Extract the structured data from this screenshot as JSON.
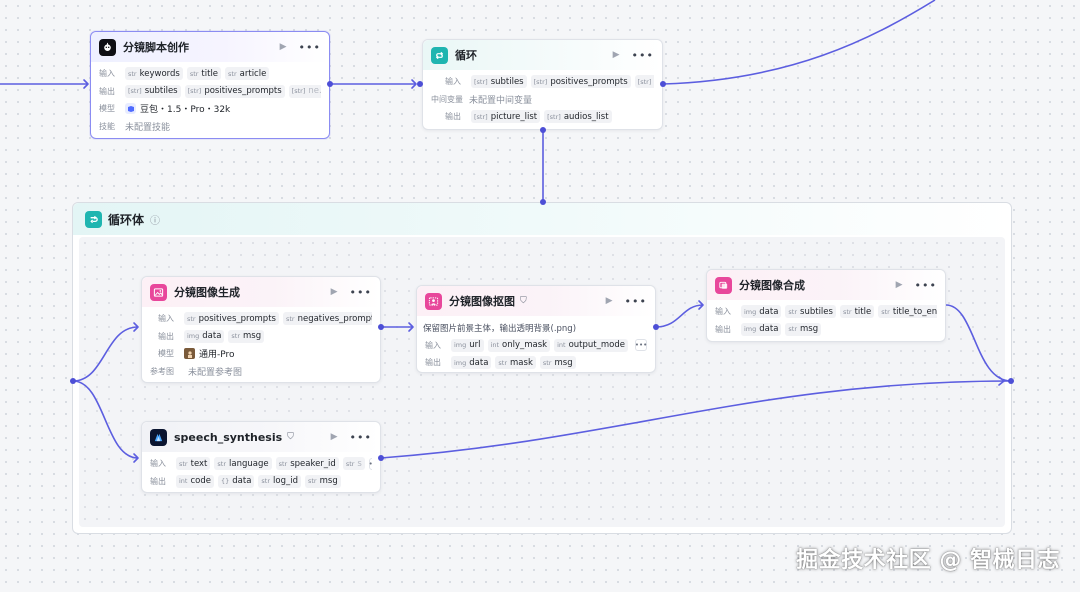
{
  "canvas": {
    "accent_color": "#5c5ee0",
    "loop_body": {
      "title": "循环体",
      "info_icon": "info-icon"
    }
  },
  "nodes": {
    "script": {
      "title": "分镜脚本创作",
      "icon": "llm-robot-icon",
      "labels": {
        "input": "输入",
        "output": "输出",
        "model": "模型",
        "skill": "技能"
      },
      "inputs": [
        {
          "type": "str",
          "name": "keywords"
        },
        {
          "type": "str",
          "name": "title"
        },
        {
          "type": "str",
          "name": "article"
        }
      ],
      "outputs": [
        {
          "type": "[str]",
          "name": "subtiles"
        },
        {
          "type": "[str]",
          "name": "positives_prompts"
        },
        {
          "type": "[str]",
          "name": "ne..."
        }
      ],
      "model": "豆包・1.5・Pro・32k",
      "skill": "未配置技能"
    },
    "loop": {
      "title": "循环",
      "icon": "loop-icon",
      "labels": {
        "input": "输入",
        "intermediate": "中间变量",
        "output": "输出"
      },
      "inputs": [
        {
          "type": "[str]",
          "name": "subtiles"
        },
        {
          "type": "[str]",
          "name": "positives_prompts"
        },
        {
          "type": "[str]",
          "name": "ne"
        }
      ],
      "intermediate": "未配置中间变量",
      "outputs": [
        {
          "type": "[str]",
          "name": "picture_list"
        },
        {
          "type": "[str]",
          "name": "audios_list"
        }
      ]
    },
    "image_gen": {
      "title": "分镜图像生成",
      "icon": "image-icon",
      "labels": {
        "input": "输入",
        "output": "输出",
        "model": "模型",
        "reference": "参考图"
      },
      "inputs": [
        {
          "type": "str",
          "name": "positives_prompts"
        },
        {
          "type": "str",
          "name": "negatives_prompts"
        }
      ],
      "outputs": [
        {
          "type": "img",
          "name": "data"
        },
        {
          "type": "str",
          "name": "msg"
        }
      ],
      "model": "通用-Pro",
      "reference": "未配置参考图"
    },
    "matting": {
      "title": "分镜图像抠图",
      "icon": "image-cutout-icon",
      "plugin_mark": "插",
      "description": "保留图片前景主体，输出透明背景(.png)",
      "labels": {
        "input": "输入",
        "output": "输出"
      },
      "inputs": [
        {
          "type": "img",
          "name": "url"
        },
        {
          "type": "int",
          "name": "only_mask"
        },
        {
          "type": "int",
          "name": "output_mode"
        }
      ],
      "outputs": [
        {
          "type": "img",
          "name": "data"
        },
        {
          "type": "str",
          "name": "mask"
        },
        {
          "type": "str",
          "name": "msg"
        }
      ]
    },
    "compose": {
      "title": "分镜图像合成",
      "icon": "image-compose-icon",
      "labels": {
        "input": "输入",
        "output": "输出"
      },
      "inputs": [
        {
          "type": "img",
          "name": "data"
        },
        {
          "type": "str",
          "name": "subtiles"
        },
        {
          "type": "str",
          "name": "title"
        },
        {
          "type": "str",
          "name": "title_to_english"
        }
      ],
      "outputs": [
        {
          "type": "img",
          "name": "data"
        },
        {
          "type": "str",
          "name": "msg"
        }
      ]
    },
    "speech": {
      "title": "speech_synthesis",
      "icon": "speech-app-icon",
      "plugin_mark": "插",
      "labels": {
        "input": "输入",
        "output": "输出"
      },
      "inputs": [
        {
          "type": "str",
          "name": "text"
        },
        {
          "type": "str",
          "name": "language"
        },
        {
          "type": "str",
          "name": "speaker_id"
        },
        {
          "type": "str",
          "name": "s"
        }
      ],
      "outputs": [
        {
          "type": "int",
          "name": "code"
        },
        {
          "type": "{}",
          "name": "data"
        },
        {
          "type": "str",
          "name": "log_id"
        },
        {
          "type": "str",
          "name": "msg"
        }
      ]
    }
  },
  "watermark": "掘金技术社区 @ 智械日志"
}
